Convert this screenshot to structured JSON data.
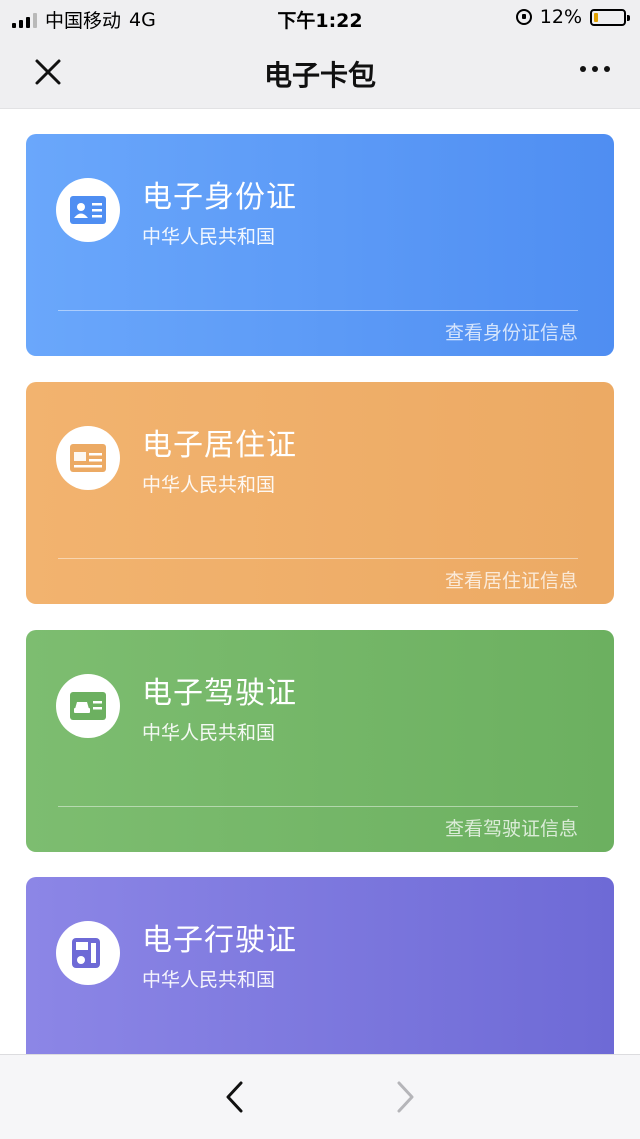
{
  "status_bar": {
    "carrier": "中国移动",
    "network": "4G",
    "time": "下午1:22",
    "battery": "12%"
  },
  "nav": {
    "title": "电子卡包"
  },
  "cards": [
    {
      "title": "电子身份证",
      "subtitle": "中华人民共和国",
      "link": "查看身份证信息",
      "icon": "id-card-icon",
      "color": "#5b99f6"
    },
    {
      "title": "电子居住证",
      "subtitle": "中华人民共和国",
      "link": "查看居住证信息",
      "icon": "residence-permit-icon",
      "color": "#efaf69"
    },
    {
      "title": "电子驾驶证",
      "subtitle": "中华人民共和国",
      "link": "查看驾驶证信息",
      "icon": "driver-license-icon",
      "color": "#74b667"
    },
    {
      "title": "电子行驶证",
      "subtitle": "中华人民共和国",
      "icon": "vehicle-license-icon",
      "color": "#7e78de"
    }
  ],
  "toolbar": {
    "back_icon": "chevron-left-icon",
    "forward_icon": "chevron-right-icon"
  }
}
